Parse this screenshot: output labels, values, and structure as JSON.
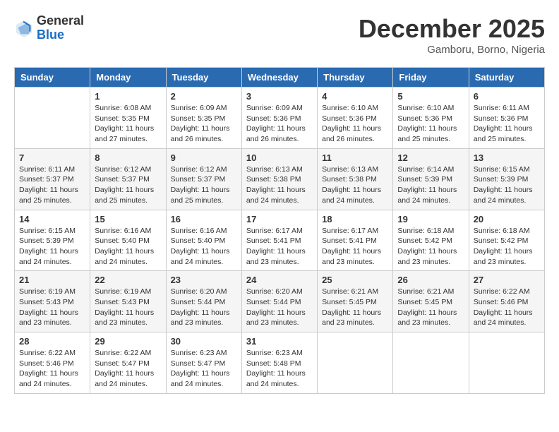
{
  "logo": {
    "general": "General",
    "blue": "Blue"
  },
  "title": "December 2025",
  "subtitle": "Gamboru, Borno, Nigeria",
  "days": [
    "Sunday",
    "Monday",
    "Tuesday",
    "Wednesday",
    "Thursday",
    "Friday",
    "Saturday"
  ],
  "weeks": [
    [
      {
        "day": "",
        "content": ""
      },
      {
        "day": "1",
        "content": "Sunrise: 6:08 AM\nSunset: 5:35 PM\nDaylight: 11 hours\nand 27 minutes."
      },
      {
        "day": "2",
        "content": "Sunrise: 6:09 AM\nSunset: 5:35 PM\nDaylight: 11 hours\nand 26 minutes."
      },
      {
        "day": "3",
        "content": "Sunrise: 6:09 AM\nSunset: 5:36 PM\nDaylight: 11 hours\nand 26 minutes."
      },
      {
        "day": "4",
        "content": "Sunrise: 6:10 AM\nSunset: 5:36 PM\nDaylight: 11 hours\nand 26 minutes."
      },
      {
        "day": "5",
        "content": "Sunrise: 6:10 AM\nSunset: 5:36 PM\nDaylight: 11 hours\nand 25 minutes."
      },
      {
        "day": "6",
        "content": "Sunrise: 6:11 AM\nSunset: 5:36 PM\nDaylight: 11 hours\nand 25 minutes."
      }
    ],
    [
      {
        "day": "7",
        "content": "Sunrise: 6:11 AM\nSunset: 5:37 PM\nDaylight: 11 hours\nand 25 minutes."
      },
      {
        "day": "8",
        "content": "Sunrise: 6:12 AM\nSunset: 5:37 PM\nDaylight: 11 hours\nand 25 minutes."
      },
      {
        "day": "9",
        "content": "Sunrise: 6:12 AM\nSunset: 5:37 PM\nDaylight: 11 hours\nand 25 minutes."
      },
      {
        "day": "10",
        "content": "Sunrise: 6:13 AM\nSunset: 5:38 PM\nDaylight: 11 hours\nand 24 minutes."
      },
      {
        "day": "11",
        "content": "Sunrise: 6:13 AM\nSunset: 5:38 PM\nDaylight: 11 hours\nand 24 minutes."
      },
      {
        "day": "12",
        "content": "Sunrise: 6:14 AM\nSunset: 5:39 PM\nDaylight: 11 hours\nand 24 minutes."
      },
      {
        "day": "13",
        "content": "Sunrise: 6:15 AM\nSunset: 5:39 PM\nDaylight: 11 hours\nand 24 minutes."
      }
    ],
    [
      {
        "day": "14",
        "content": "Sunrise: 6:15 AM\nSunset: 5:39 PM\nDaylight: 11 hours\nand 24 minutes."
      },
      {
        "day": "15",
        "content": "Sunrise: 6:16 AM\nSunset: 5:40 PM\nDaylight: 11 hours\nand 24 minutes."
      },
      {
        "day": "16",
        "content": "Sunrise: 6:16 AM\nSunset: 5:40 PM\nDaylight: 11 hours\nand 24 minutes."
      },
      {
        "day": "17",
        "content": "Sunrise: 6:17 AM\nSunset: 5:41 PM\nDaylight: 11 hours\nand 23 minutes."
      },
      {
        "day": "18",
        "content": "Sunrise: 6:17 AM\nSunset: 5:41 PM\nDaylight: 11 hours\nand 23 minutes."
      },
      {
        "day": "19",
        "content": "Sunrise: 6:18 AM\nSunset: 5:42 PM\nDaylight: 11 hours\nand 23 minutes."
      },
      {
        "day": "20",
        "content": "Sunrise: 6:18 AM\nSunset: 5:42 PM\nDaylight: 11 hours\nand 23 minutes."
      }
    ],
    [
      {
        "day": "21",
        "content": "Sunrise: 6:19 AM\nSunset: 5:43 PM\nDaylight: 11 hours\nand 23 minutes."
      },
      {
        "day": "22",
        "content": "Sunrise: 6:19 AM\nSunset: 5:43 PM\nDaylight: 11 hours\nand 23 minutes."
      },
      {
        "day": "23",
        "content": "Sunrise: 6:20 AM\nSunset: 5:44 PM\nDaylight: 11 hours\nand 23 minutes."
      },
      {
        "day": "24",
        "content": "Sunrise: 6:20 AM\nSunset: 5:44 PM\nDaylight: 11 hours\nand 23 minutes."
      },
      {
        "day": "25",
        "content": "Sunrise: 6:21 AM\nSunset: 5:45 PM\nDaylight: 11 hours\nand 23 minutes."
      },
      {
        "day": "26",
        "content": "Sunrise: 6:21 AM\nSunset: 5:45 PM\nDaylight: 11 hours\nand 23 minutes."
      },
      {
        "day": "27",
        "content": "Sunrise: 6:22 AM\nSunset: 5:46 PM\nDaylight: 11 hours\nand 24 minutes."
      }
    ],
    [
      {
        "day": "28",
        "content": "Sunrise: 6:22 AM\nSunset: 5:46 PM\nDaylight: 11 hours\nand 24 minutes."
      },
      {
        "day": "29",
        "content": "Sunrise: 6:22 AM\nSunset: 5:47 PM\nDaylight: 11 hours\nand 24 minutes."
      },
      {
        "day": "30",
        "content": "Sunrise: 6:23 AM\nSunset: 5:47 PM\nDaylight: 11 hours\nand 24 minutes."
      },
      {
        "day": "31",
        "content": "Sunrise: 6:23 AM\nSunset: 5:48 PM\nDaylight: 11 hours\nand 24 minutes."
      },
      {
        "day": "",
        "content": ""
      },
      {
        "day": "",
        "content": ""
      },
      {
        "day": "",
        "content": ""
      }
    ]
  ]
}
